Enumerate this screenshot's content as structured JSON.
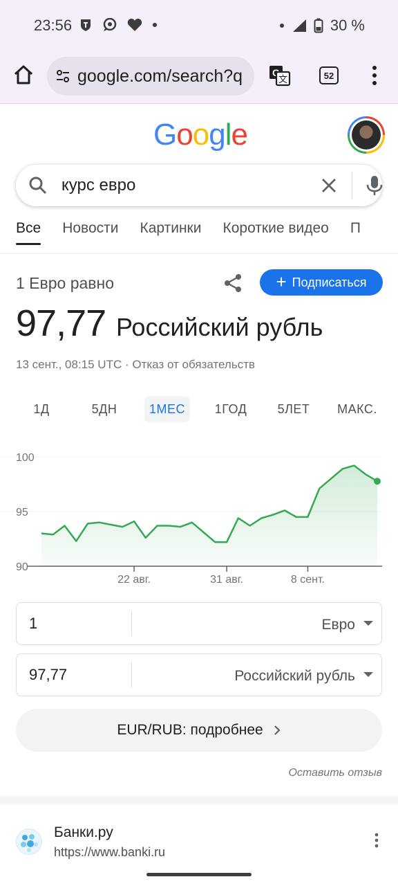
{
  "status_bar": {
    "time": "23:56",
    "battery": "30 %",
    "icons": [
      "vpn-icon",
      "chat-bubble-icon",
      "heart-icon",
      "dot-icon",
      "signal-icon",
      "battery-icon"
    ]
  },
  "browser": {
    "url": "google.com/search?q",
    "tab_count": "52",
    "icons": [
      "home-icon",
      "site-settings-icon",
      "translate-icon",
      "tabs-icon",
      "more-vert-icon"
    ]
  },
  "search": {
    "query": "курс евро"
  },
  "filter_tabs": [
    {
      "label": "Все",
      "active": true
    },
    {
      "label": "Новости",
      "active": false
    },
    {
      "label": "Картинки",
      "active": false
    },
    {
      "label": "Короткие видео",
      "active": false
    },
    {
      "label": "П",
      "active": false
    }
  ],
  "converter": {
    "equals_label": "1 Евро равно",
    "subscribe_label": "Подписаться",
    "rate_value": "97,77",
    "rate_currency": "Российский рубль",
    "meta": "13 сент., 08:15 UTC · Отказ от обязательств",
    "ranges": [
      {
        "label": "1Д",
        "active": false
      },
      {
        "label": "5ДН",
        "active": false
      },
      {
        "label": "1МЕС",
        "active": true
      },
      {
        "label": "1ГОД",
        "active": false
      },
      {
        "label": "5ЛЕТ",
        "active": false
      },
      {
        "label": "МАКС.",
        "active": false
      }
    ],
    "from_amount": "1",
    "from_unit": "Евро",
    "to_amount": "97,77",
    "to_unit": "Российский рубль",
    "details_label": "EUR/RUB: подробнее",
    "feedback_label": "Оставить отзыв"
  },
  "chart_data": {
    "type": "area",
    "ylim": [
      90,
      100
    ],
    "yticks": [
      "100",
      "95",
      "90"
    ],
    "xticks": [
      "22 авг.",
      "31 авг.",
      "8 сент."
    ],
    "color": "#34a853",
    "values": [
      93.0,
      92.9,
      93.7,
      92.3,
      93.9,
      94.0,
      93.8,
      93.6,
      94.1,
      92.6,
      93.7,
      93.7,
      93.6,
      94.0,
      93.1,
      92.2,
      92.2,
      94.4,
      93.7,
      94.4,
      94.7,
      95.1,
      94.5,
      94.5,
      97.1,
      98.0,
      98.9,
      99.2,
      98.4,
      97.77
    ]
  },
  "result": {
    "title": "Банки.ру",
    "url": "https://www.banki.ru"
  }
}
